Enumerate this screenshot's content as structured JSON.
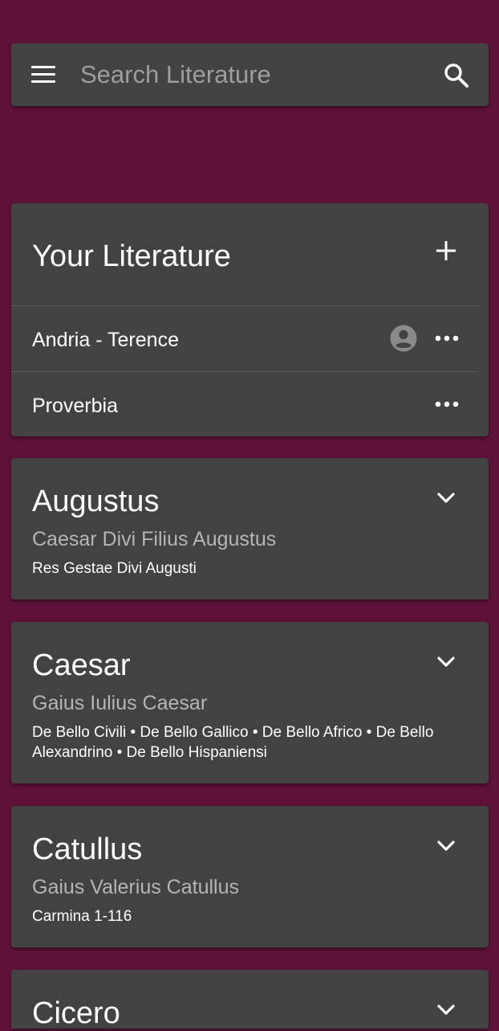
{
  "search": {
    "placeholder": "Search Literature"
  },
  "icons": {
    "menu": "menu-icon",
    "search": "search-icon",
    "add": "add-icon",
    "more": "more-horizontal-icon",
    "person": "account-circle-icon",
    "expand": "chevron-down-icon"
  },
  "colors": {
    "background": "#5e1238",
    "card": "#424242",
    "secondary_text": "#b5b5b5"
  },
  "your_literature": {
    "title": "Your Literature",
    "items": [
      {
        "label": "Andria - Terence",
        "has_owner_icon": true
      },
      {
        "label": "Proverbia",
        "has_owner_icon": false
      }
    ]
  },
  "authors": [
    {
      "name": "Augustus",
      "full_name": "Caesar Divi Filius Augustus",
      "works": "Res Gestae Divi Augusti"
    },
    {
      "name": "Caesar",
      "full_name": "Gaius Iulius Caesar",
      "works": "De Bello Civili • De Bello Gallico • De Bello Africo • De Bello Alexandrino • De Bello Hispaniensi"
    },
    {
      "name": "Catullus",
      "full_name": "Gaius Valerius Catullus",
      "works": "Carmina 1-116"
    },
    {
      "name": "Cicero",
      "full_name": "",
      "works": ""
    }
  ]
}
